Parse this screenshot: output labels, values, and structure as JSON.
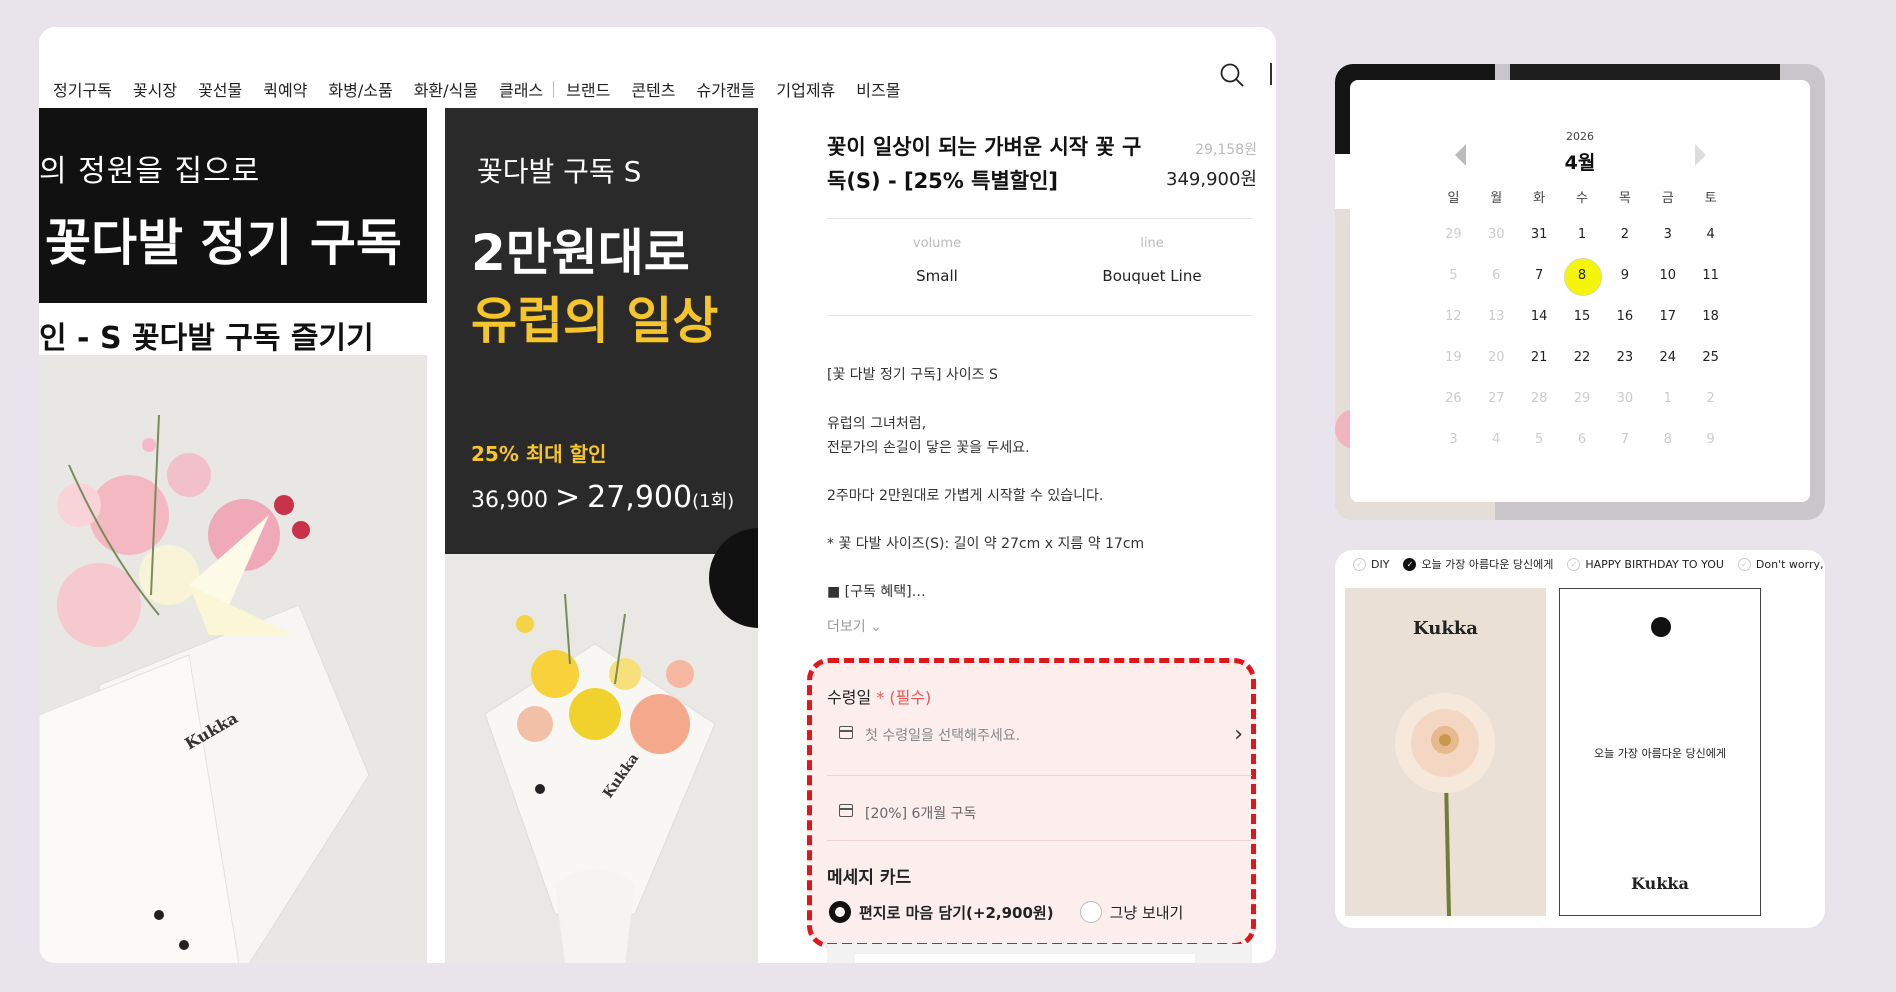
{
  "nav": {
    "items": [
      "정기구독",
      "꽃시장",
      "꽃선물",
      "퀵예약",
      "화병/소품",
      "화환/식물",
      "클래스",
      "브랜드",
      "콘텐츠",
      "슈가캔들",
      "기업제휴",
      "비즈몰"
    ]
  },
  "banner1": {
    "line1": "의 정원을 집으로",
    "line2": "꽃다발 정기 구독",
    "line3": "인 - S 꽃다발 구독 즐기기",
    "logo": "Kukka"
  },
  "banner2": {
    "sub": "꽃다발 구독 S",
    "headline1": "2만원대로",
    "headline2": "유럽의 일상",
    "promo": "25% 최대 할인",
    "price_old": "36,900",
    "price_arrow": ">",
    "price_new": "27,900",
    "price_unit": "(1회)",
    "logo": "Kukka"
  },
  "product": {
    "title": "꽃이 일상이 되는 가벼운 시작 꽃 구독(S) - [25% 특별할인]",
    "old_price": "29,158원",
    "price": "349,900원",
    "options": [
      {
        "label": "volume",
        "value": "Small"
      },
      {
        "label": "line",
        "value": "Bouquet Line"
      }
    ],
    "description": [
      "[꽃 다발 정기 구독] 사이즈 S",
      "유럽의 그녀처럼,",
      "전문가의 손길이 닿은 꽃을 두세요.",
      "2주마다 2만원대로 가볍게 시작할 수 있습니다.",
      "* 꽃 다발 사이즈(S): 길이 약 27cm x 지름 약 17cm",
      "■ [구독 혜택]…"
    ],
    "more": "더보기"
  },
  "order": {
    "receive_label": "수령일",
    "required": "* (필수)",
    "date_placeholder": "첫 수령일을 선택해주세요.",
    "plan": "[20%] 6개월 구독",
    "card_label": "메세지 카드",
    "radio_options": [
      {
        "label": "편지로 마음 담기(+2,900원)",
        "selected": true
      },
      {
        "label": "그냥 보내기",
        "selected": false
      }
    ]
  },
  "calendar": {
    "year": "2026",
    "month": "4월",
    "weekdays": [
      "일",
      "월",
      "화",
      "수",
      "목",
      "금",
      "토"
    ],
    "weeks": [
      [
        [
          "29",
          true
        ],
        [
          "30",
          true
        ],
        [
          "31",
          false
        ],
        [
          "1",
          false
        ],
        [
          "2",
          false
        ],
        [
          "3",
          false
        ],
        [
          "4",
          false
        ]
      ],
      [
        [
          "5",
          true
        ],
        [
          "6",
          true
        ],
        [
          "7",
          false
        ],
        [
          "8",
          false
        ],
        [
          "9",
          false
        ],
        [
          "10",
          false
        ],
        [
          "11",
          false
        ]
      ],
      [
        [
          "12",
          true
        ],
        [
          "13",
          true
        ],
        [
          "14",
          false
        ],
        [
          "15",
          false
        ],
        [
          "16",
          false
        ],
        [
          "17",
          false
        ],
        [
          "18",
          false
        ]
      ],
      [
        [
          "19",
          true
        ],
        [
          "20",
          true
        ],
        [
          "21",
          false
        ],
        [
          "22",
          false
        ],
        [
          "23",
          false
        ],
        [
          "24",
          false
        ],
        [
          "25",
          false
        ]
      ],
      [
        [
          "26",
          true
        ],
        [
          "27",
          true
        ],
        [
          "28",
          true
        ],
        [
          "29",
          true
        ],
        [
          "30",
          true
        ],
        [
          "1",
          true
        ],
        [
          "2",
          true
        ]
      ],
      [
        [
          "3",
          true
        ],
        [
          "4",
          true
        ],
        [
          "5",
          true
        ],
        [
          "6",
          true
        ],
        [
          "7",
          true
        ],
        [
          "8",
          true
        ],
        [
          "9",
          true
        ]
      ]
    ],
    "selected_day": "8",
    "highlight_color": "#f5f50a"
  },
  "gallery": {
    "tabs": [
      {
        "label": "DIY",
        "checked": false
      },
      {
        "label": "오늘 가장 아름다운 당신에게",
        "checked": true
      },
      {
        "label": "HAPPY BIRTHDAY TO YOU",
        "checked": false
      },
      {
        "label": "Don't worry, Be",
        "checked": false
      }
    ],
    "card1_logo": "Kukka",
    "card2_message": "오늘 가장 아름다운 당신에게",
    "card2_logo": "Kukka"
  },
  "colors": {
    "accent_yellow": "#f6c42b",
    "highlight_red": "#e0171a",
    "highlight_bg": "#fdeeee"
  }
}
